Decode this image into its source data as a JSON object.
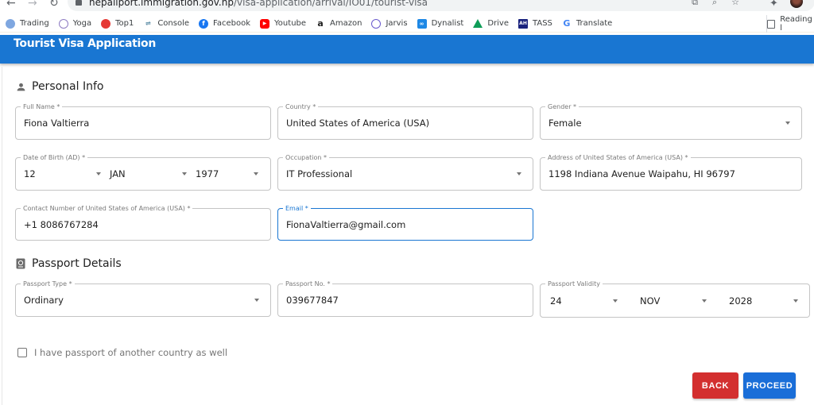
{
  "browser": {
    "url_host": "nepaliport.immigration.gov.np",
    "url_path": "/visa-application/arrival/IO01/tourist-visa",
    "bookmarks": [
      {
        "label": "Trading",
        "icon": "trading-icon",
        "color": "#7fa7e0"
      },
      {
        "label": "Yoga",
        "icon": "yoga-icon",
        "color": "#8e7cc3"
      },
      {
        "label": "Top1",
        "icon": "top1-icon",
        "color": "#e53935"
      },
      {
        "label": "Console",
        "icon": "console-icon",
        "color": "#5f8fa8"
      },
      {
        "label": "Facebook",
        "icon": "facebook-icon",
        "color": "#1877f2"
      },
      {
        "label": "Youtube",
        "icon": "youtube-icon",
        "color": "#ff0000"
      },
      {
        "label": "Amazon",
        "icon": "amazon-icon",
        "color": "#222222"
      },
      {
        "label": "Jarvis",
        "icon": "jarvis-icon",
        "color": "#6a5acd"
      },
      {
        "label": "Dynalist",
        "icon": "dynalist-icon",
        "color": "#1e88e5"
      },
      {
        "label": "Drive",
        "icon": "drive-icon",
        "color": "#0f9d58"
      },
      {
        "label": "TASS",
        "icon": "tass-icon",
        "color": "#1a237e"
      },
      {
        "label": "Translate",
        "icon": "google-icon",
        "color": "#4285f4"
      }
    ],
    "reading_list_label": "Reading l"
  },
  "header": {
    "title": "Tourist Visa Application",
    "color": "#1976d2"
  },
  "personal_info": {
    "title": "Personal Info",
    "full_name": {
      "label": "Full Name *",
      "value": "Fiona Valtierra"
    },
    "country": {
      "label": "Country *",
      "value": "United States of America (USA)"
    },
    "gender": {
      "label": "Gender *",
      "value": "Female"
    },
    "dob": {
      "label": "Date of Birth (AD) *",
      "day": "12",
      "month": "JAN",
      "year": "1977"
    },
    "occupation": {
      "label": "Occupation *",
      "value": "IT Professional"
    },
    "address": {
      "label": "Address of United States of America (USA) *",
      "value": "1198 Indiana Avenue Waipahu, HI 96797"
    },
    "contact": {
      "label": "Contact Number of United States of America (USA) *",
      "value": "+1 8086767284"
    },
    "email": {
      "label": "Email *",
      "value": "FionaValtierra@gmail.com"
    }
  },
  "passport": {
    "title": "Passport Details",
    "type": {
      "label": "Passport Type *",
      "value": "Ordinary"
    },
    "number": {
      "label": "Passport No. *",
      "value": "039677847"
    },
    "validity": {
      "label": "Passport Validity",
      "day": "24",
      "month": "NOV",
      "year": "2028"
    }
  },
  "other_passport_checkbox": {
    "label": "I have passport of another country as well",
    "checked": false
  },
  "actions": {
    "back_label": "BACK",
    "proceed_label": "PROCEED",
    "back_color": "#d32f2f",
    "proceed_color": "#1a6ed8"
  }
}
